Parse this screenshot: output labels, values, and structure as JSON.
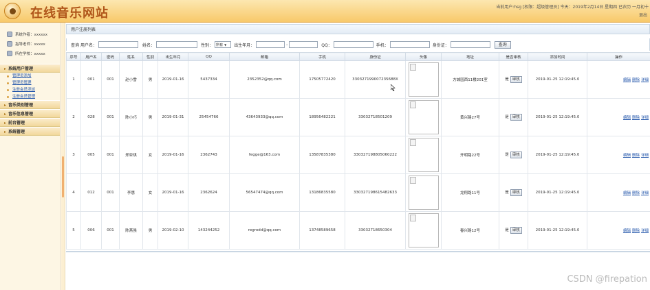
{
  "header": {
    "site_title": "在线音乐网站",
    "user_info": "当前用户:hsg [权限：超级管理员] 今天：2019年2月14日 星期四 已农历 一月初十",
    "logout": "退出"
  },
  "sidebar": {
    "info": [
      {
        "label": "系统作者：xxxxxx",
        "icon": "author-icon"
      },
      {
        "label": "指导老师：xxxxx",
        "icon": "teacher-icon"
      },
      {
        "label": "所在学校：xxxxx",
        "icon": "school-icon"
      }
    ],
    "groups": [
      {
        "label": "系统用户管理",
        "items": [
          "管理员添加",
          "管理员管理",
          "注册会员添加",
          "注册会员管理"
        ]
      },
      {
        "label": "音乐类别管理",
        "items": []
      },
      {
        "label": "音乐信息管理",
        "items": []
      },
      {
        "label": "前台管理",
        "items": []
      },
      {
        "label": "系统管理",
        "items": []
      }
    ]
  },
  "main": {
    "panel_title": "用户注册列表",
    "search": {
      "prefix": "查询",
      "username_label": "用户名：",
      "name_label": "姓名：",
      "gender_label": "性别：",
      "gender_value": "所有",
      "birth_label": "出生年月：",
      "birth_sep": "-",
      "qq_label": "QQ：",
      "phone_label": "手机：",
      "idcard_label": "身份证：",
      "submit_label": "查询"
    },
    "columns": [
      "序号",
      "用户名",
      "密码",
      "姓名",
      "性别",
      "出生年月",
      "QQ",
      "邮箱",
      "手机",
      "身份证",
      "头像",
      "地址",
      "是否审核",
      "添加时间",
      "操作"
    ],
    "rows": [
      {
        "no": "1",
        "username": "001",
        "password": "001",
        "name": "赵小雪",
        "gender": "男",
        "birth": "2019-01-16",
        "qq": "5437334",
        "email": "2352352@qq.com",
        "phone": "17505772420",
        "idcard": "330327199007235688X",
        "address": "方城园西11楼201室",
        "audit": "是",
        "audit_btn": "审核",
        "added": "2019-01-25 12:19:45.0",
        "ops": [
          "编辑",
          "删除",
          "详细"
        ]
      },
      {
        "no": "2",
        "username": "028",
        "password": "001",
        "name": "陈小巧",
        "gender": "男",
        "birth": "2019-01-31",
        "qq": "25454766",
        "email": "43643933@qq.com",
        "phone": "18956482221",
        "idcard": "33032718501209",
        "address": "黄兴路27号",
        "audit": "是",
        "audit_btn": "审核",
        "added": "2019-01-25 12:19:45.0",
        "ops": [
          "编辑",
          "删除",
          "详细"
        ]
      },
      {
        "no": "3",
        "username": "005",
        "password": "001",
        "name": "郑亚琪",
        "gender": "女",
        "birth": "2019-01-16",
        "qq": "2362743",
        "email": "fegge@163.com",
        "phone": "13587835380",
        "idcard": "330327198805060222",
        "address": "开明路22号",
        "audit": "是",
        "audit_btn": "审核",
        "added": "2019-01-25 12:19:45.0",
        "ops": [
          "编辑",
          "删除",
          "详细"
        ]
      },
      {
        "no": "4",
        "username": "012",
        "password": "001",
        "name": "李惠",
        "gender": "女",
        "birth": "2019-01-16",
        "qq": "2362624",
        "email": "56547474@qq.com",
        "phone": "13186835580",
        "idcard": "330327198615482633",
        "address": "龙翔路11号",
        "audit": "是",
        "audit_btn": "审核",
        "added": "2019-01-25 12:19:45.0",
        "ops": [
          "编辑",
          "删除",
          "详细"
        ]
      },
      {
        "no": "5",
        "username": "006",
        "password": "001",
        "name": "陈燕强",
        "gender": "男",
        "birth": "2019-02-10",
        "qq": "143244252",
        "email": "regrodd@qq.com",
        "phone": "13748589658",
        "idcard": "33032718650304",
        "address": "春兴路12号",
        "audit": "是",
        "audit_btn": "审核",
        "added": "2019-01-25 12:19:45.0",
        "ops": [
          "编辑",
          "删除",
          "详细"
        ]
      }
    ]
  },
  "watermark": "CSDN @firepation"
}
